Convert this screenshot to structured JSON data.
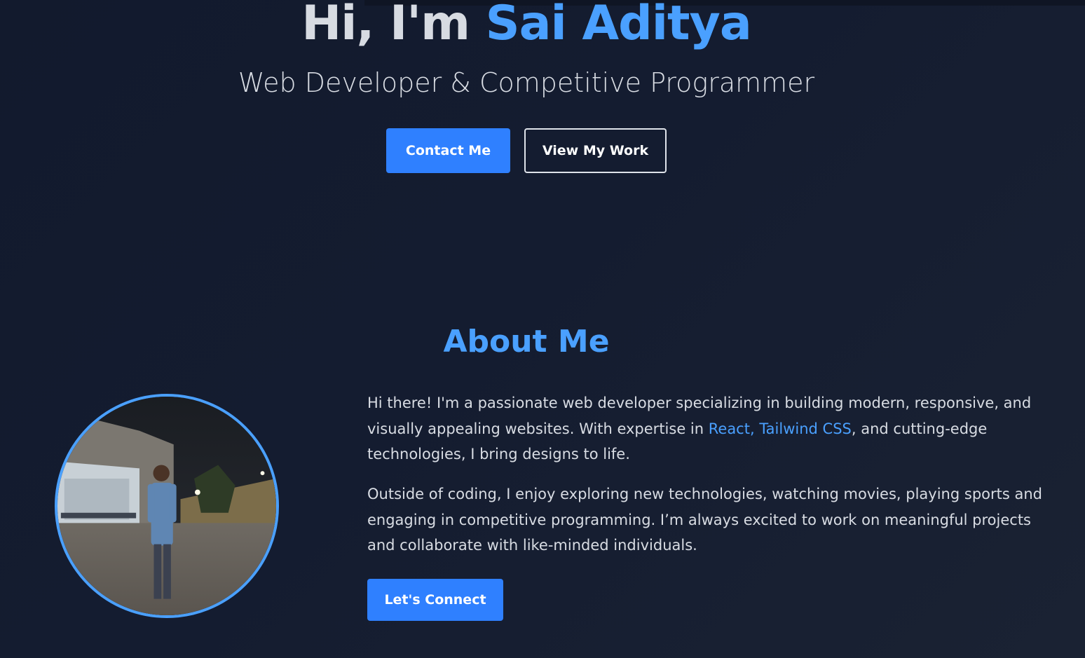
{
  "hero": {
    "greeting": "Hi, I'm ",
    "name": "Sai Aditya",
    "subtitle": "Web Developer & Competitive Programmer",
    "contact_label": "Contact Me",
    "work_label": "View My Work"
  },
  "about": {
    "title": "About Me",
    "p1_before": "Hi there! I'm a passionate web developer specializing in building modern, responsive, and visually appealing websites. With expertise in ",
    "p1_highlight": "React, Tailwind CSS",
    "p1_after": ", and cutting-edge technologies, I bring designs to life.",
    "p2": "Outside of coding, I enjoy exploring new technologies, watching movies, playing sports and engaging in competitive programming. I’m always excited to work on meaningful projects and collaborate with like-minded individuals.",
    "connect_label": "Let's Connect"
  },
  "colors": {
    "accent": "#4aa0ff",
    "button": "#2f80ff",
    "background": "#131b2e",
    "text": "#d8dce3"
  }
}
